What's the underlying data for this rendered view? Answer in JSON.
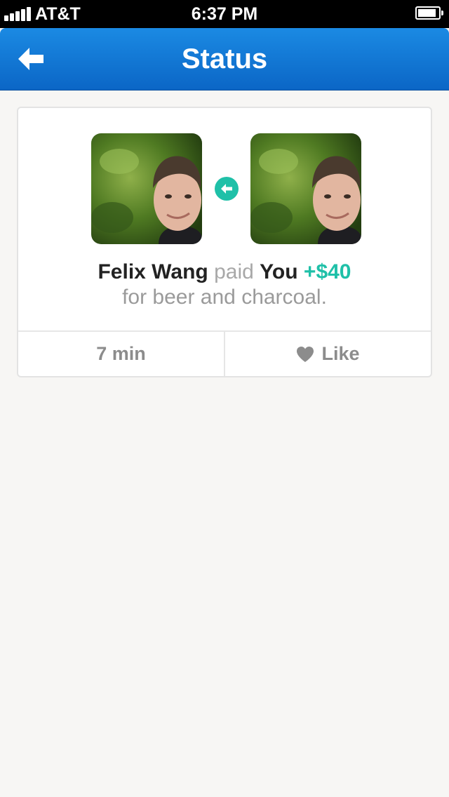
{
  "status_bar": {
    "carrier": "AT&T",
    "time": "6:37 PM",
    "signal_bars": 5,
    "battery_level": 0.9
  },
  "nav": {
    "title": "Status",
    "back_icon": "back-arrow-icon"
  },
  "payment": {
    "payer": "Felix Wang",
    "verb": "paid",
    "payee": "You",
    "amount": "+$40",
    "memo": "for beer and charcoal.",
    "direction_icon": "arrow-left-icon"
  },
  "footer": {
    "time_ago": "7 min",
    "like_label": "Like",
    "like_icon": "heart-icon"
  },
  "colors": {
    "accent": "#1fc0a8",
    "nav_top": "#1b8ae3",
    "nav_bottom": "#0b66c6",
    "background": "#f7f6f4"
  }
}
